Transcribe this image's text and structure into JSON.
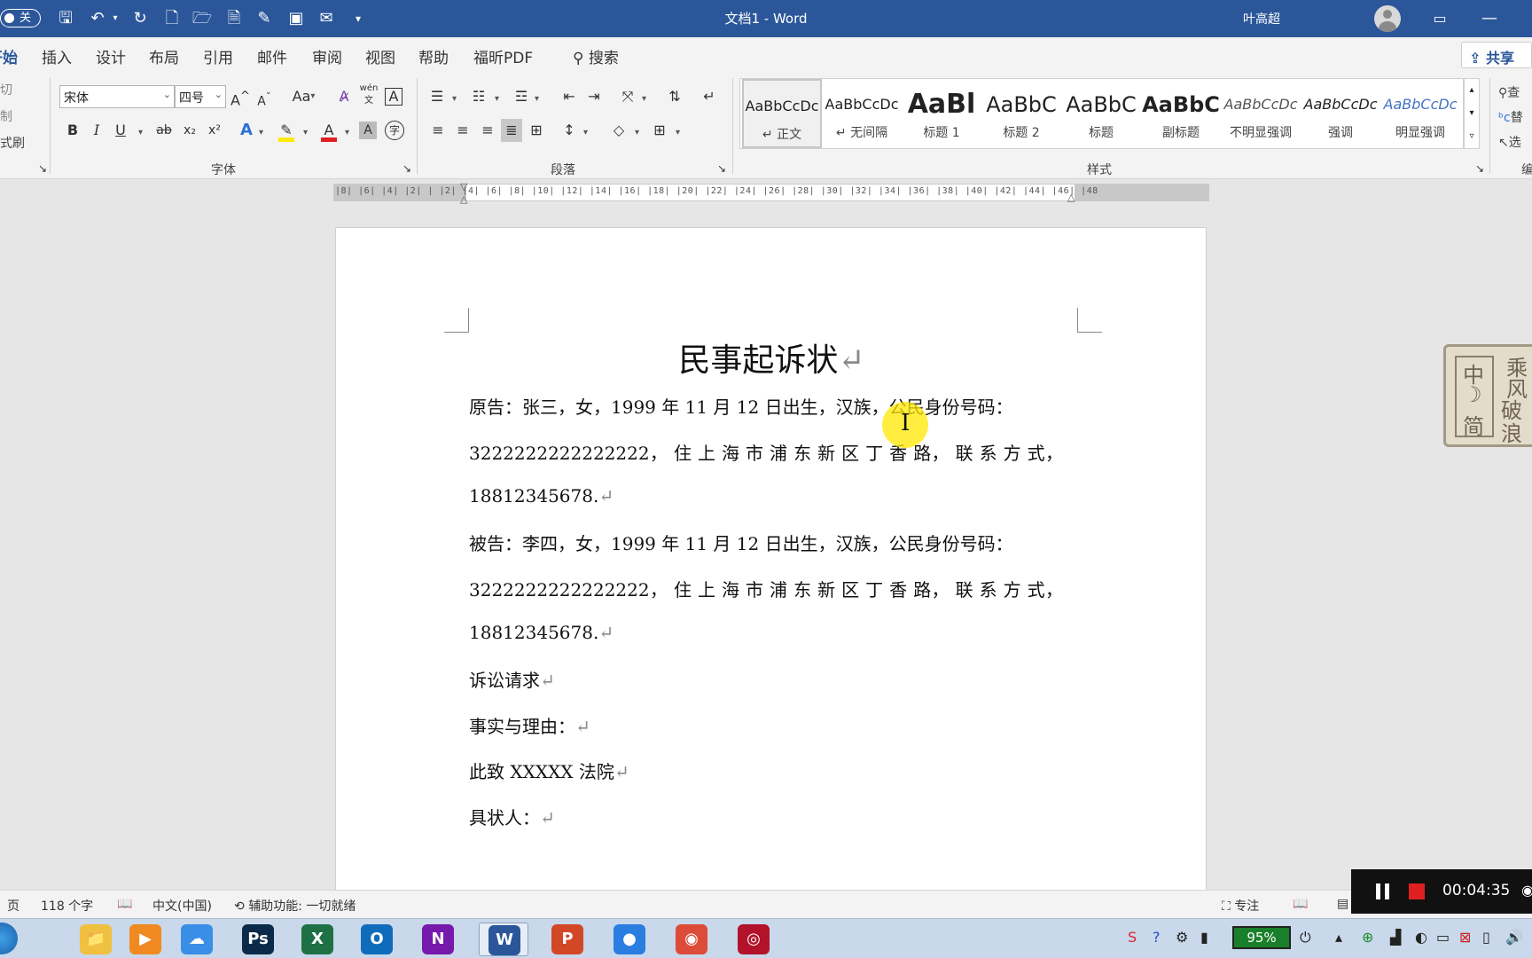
{
  "titlebar": {
    "autosave_label": "关",
    "doc_title": "文档1  -  Word",
    "user_name": "叶高超"
  },
  "tabs": [
    {
      "label": "开始"
    },
    {
      "label": "插入"
    },
    {
      "label": "设计"
    },
    {
      "label": "布局"
    },
    {
      "label": "引用"
    },
    {
      "label": "邮件"
    },
    {
      "label": "审阅"
    },
    {
      "label": "视图"
    },
    {
      "label": "帮助"
    },
    {
      "label": "福昕PDF"
    }
  ],
  "search_label": "搜索",
  "share_label": "共享",
  "ribbon": {
    "clipboard": {
      "cut": "剪切",
      "copy": "复制",
      "format_painter": "格式刷"
    },
    "font": {
      "font_name": "宋体",
      "font_size": "四号",
      "group_label": "字体",
      "grow_label": "A",
      "shrink_label": "A",
      "case_label": "Aa",
      "phonetic_label": "wén",
      "border_char": "A",
      "bold": "B",
      "italic": "I",
      "underline": "U",
      "strike": "ab",
      "subscript": "x₂",
      "superscript": "x²",
      "effect": "A",
      "highlight_color": "#ffea00",
      "font_color": "#e02020",
      "font_color_label": "A",
      "shading_label": "A",
      "enclose_label": "字"
    },
    "paragraph": {
      "group_label": "段落"
    },
    "styles": {
      "group_label": "样式",
      "items": [
        {
          "sample": "AaBbCcDc",
          "name": "↵ 正文"
        },
        {
          "sample": "AaBbCcDc",
          "name": "↵ 无间隔"
        },
        {
          "sample": "AaBl",
          "name": "标题 1"
        },
        {
          "sample": "AaBbC",
          "name": "标题 2"
        },
        {
          "sample": "AaBbC",
          "name": "标题"
        },
        {
          "sample": "AaBbC",
          "name": "副标题"
        },
        {
          "sample": "AaBbCcDc",
          "name": "不明显强调"
        },
        {
          "sample": "AaBbCcDc",
          "name": "强调"
        },
        {
          "sample": "AaBbCcDc",
          "name": "明显强调"
        }
      ]
    },
    "editing": {
      "find": "查",
      "replace": "替",
      "select": "选"
    },
    "last_group_label": "编"
  },
  "ruler_text": "|8|  |6|  |4|  |2|  |    |2|  |4|  |6|  |8|  |10|  |12|  |14|  |16|  |18|  |20|  |22|  |24|  |26|  |28|  |30|  |32|  |34|  |36|  |38|  |40|  |42|  |44|  |46|  |48",
  "document": {
    "title": "民事起诉状",
    "lines": [
      "原告：张三，女，1999 年 11 月 12 日出生，汉族，公民身份号码：",
      "3222222222222222， 住 上 海 市 浦 东 新 区 丁 香 路， 联 系 方 式，",
      "18812345678.",
      "被告：李四，女，1999 年 11 月 12 日出生，汉族，公民身份号码：",
      "3222222222222222， 住 上 海 市 浦 东 新 区 丁 香 路， 联 系 方 式，",
      "18812345678.",
      "诉讼请求",
      "事实与理由：",
      "此致 XXXXX 法院",
      "具状人："
    ],
    "paragraph_mark": "↵"
  },
  "seal": {
    "left": [
      "中",
      "☽",
      "简"
    ],
    "right": [
      "乘",
      "风",
      "破",
      "浪"
    ]
  },
  "statusbar": {
    "page": "页",
    "word_count": "118 个字",
    "language": "中文(中国)",
    "accessibility": "辅助功能: 一切就绪",
    "focus": "专注"
  },
  "recorder": {
    "time": "00:04:35"
  },
  "taskbar": {
    "apps": [
      {
        "name": "explorer",
        "label": "📁",
        "color": "#f0c040"
      },
      {
        "name": "media",
        "label": "▶",
        "color": "#f08a20"
      },
      {
        "name": "baidu-netdisk",
        "label": "☁",
        "color": "#3a8ee6"
      },
      {
        "name": "photoshop",
        "label": "Ps",
        "color": "#0b2a4a"
      },
      {
        "name": "excel",
        "label": "X",
        "color": "#1e7145"
      },
      {
        "name": "outlook",
        "label": "O",
        "color": "#0f6cbd"
      },
      {
        "name": "onenote",
        "label": "N",
        "color": "#7719aa"
      },
      {
        "name": "word",
        "label": "W",
        "color": "#2b579a"
      },
      {
        "name": "powerpoint",
        "label": "P",
        "color": "#d24726"
      },
      {
        "name": "chat",
        "label": "●",
        "color": "#2a7de1"
      },
      {
        "name": "chrome",
        "label": "◉",
        "color": "#dd4b39"
      },
      {
        "name": "recorder",
        "label": "◎",
        "color": "#b3122b"
      }
    ],
    "battery": "95%"
  }
}
